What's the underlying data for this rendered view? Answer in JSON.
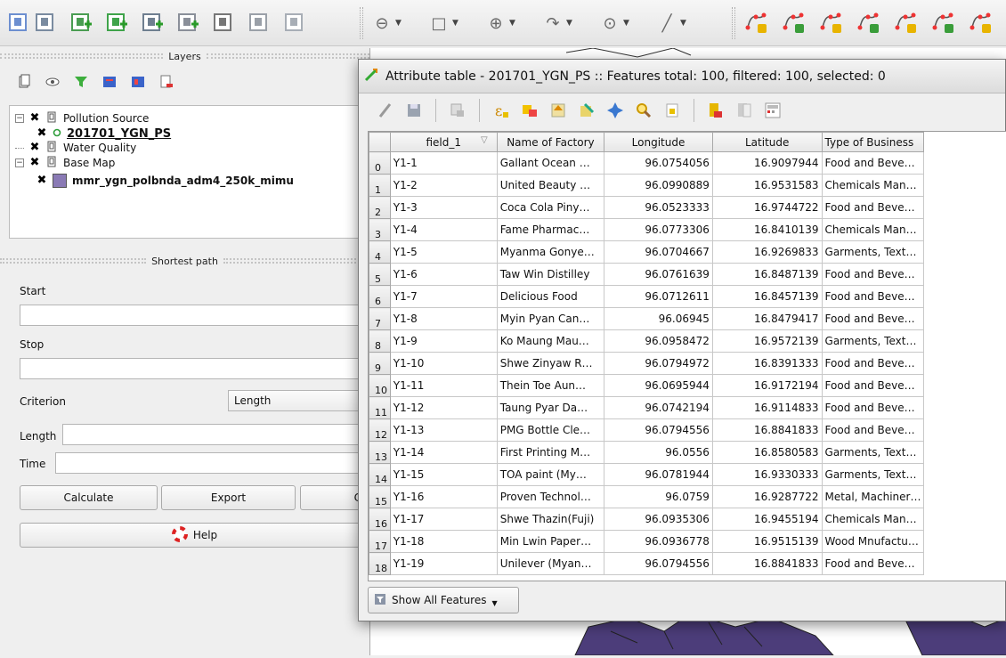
{
  "toolbar": {
    "icons": [
      "add-layer-icon",
      "remove-layer-icon",
      "new-vector-icon",
      "add-feature-icon",
      "edit-vector-icon",
      "edit-vector2-icon",
      "identify-icon",
      "open-table-icon",
      "open-table2-icon"
    ],
    "dropdown_icons": [
      "pan-icon",
      "select-rect-icon",
      "measure-icon",
      "action-icon",
      "node-icon",
      "line-icon"
    ],
    "edit_icons": [
      "digitize1-icon",
      "digitize2-icon",
      "digitize3-icon",
      "digitize4-icon",
      "digitize5-icon",
      "digitize6-icon",
      "digitize7-icon"
    ]
  },
  "layers_panel": {
    "title": "Layers",
    "tree": [
      {
        "label": "Pollution Source",
        "level": 0,
        "expanded": true
      },
      {
        "label": "201701_YGN_PS",
        "level": 1,
        "bold": true,
        "underline": true
      },
      {
        "label": "Water Quality",
        "level": 0
      },
      {
        "label": "Base Map",
        "level": 0,
        "expanded": true
      },
      {
        "label": "mmr_ygn_polbnda_adm4_250k_mimu",
        "level": 1,
        "bold": true
      }
    ],
    "colors": {
      "polygon_swatch": "#8a7ab5",
      "point_symbol": "#2e9d3a"
    }
  },
  "shortest_path": {
    "title": "Shortest path",
    "start_label": "Start",
    "stop_label": "Stop",
    "criterion_label": "Criterion",
    "criterion_value": "Length",
    "length_label": "Length",
    "time_label": "Time",
    "calculate": "Calculate",
    "export": "Export",
    "clear_partial": "C",
    "help": "Help"
  },
  "attribute_table": {
    "title": "Attribute table - 201701_YGN_PS :: Features total: 100, filtered: 100, selected: 0",
    "columns": [
      "field_1",
      "Name of Factory",
      "Longitude",
      "Latitude",
      "Type of Business"
    ],
    "rows": [
      [
        "0",
        "Y1-1",
        "Gallant Ocean …",
        "96.0754056",
        "16.9097944",
        "Food and Beve…"
      ],
      [
        "1",
        "Y1-2",
        "United Beauty …",
        "96.0990889",
        "16.9531583",
        "Chemicals Man…"
      ],
      [
        "2",
        "Y1-3",
        "Coca Cola Piny…",
        "96.0523333",
        "16.9744722",
        "Food and Beve…"
      ],
      [
        "3",
        "Y1-4",
        "Fame Pharmac…",
        "96.0773306",
        "16.8410139",
        "Chemicals Man…"
      ],
      [
        "4",
        "Y1-5",
        "Myanma Gonye…",
        "96.0704667",
        "16.9269833",
        "Garments, Text…"
      ],
      [
        "5",
        "Y1-6",
        "Taw Win Distilley",
        "96.0761639",
        "16.8487139",
        "Food and Beve…"
      ],
      [
        "6",
        "Y1-7",
        "Delicious Food",
        "96.0712611",
        "16.8457139",
        "Food and Beve…"
      ],
      [
        "7",
        "Y1-8",
        "Myin Pyan Can…",
        "96.06945",
        "16.8479417",
        "Food and Beve…"
      ],
      [
        "8",
        "Y1-9",
        "Ko Maung Mau…",
        "96.0958472",
        "16.9572139",
        "Garments, Text…"
      ],
      [
        "9",
        "Y1-10",
        "Shwe Zinyaw R…",
        "96.0794972",
        "16.8391333",
        "Food and Beve…"
      ],
      [
        "10",
        "Y1-11",
        "Thein Toe Aun…",
        "96.0695944",
        "16.9172194",
        "Food and Beve…"
      ],
      [
        "11",
        "Y1-12",
        "Taung Pyar Da…",
        "96.0742194",
        "16.9114833",
        "Food and Beve…"
      ],
      [
        "12",
        "Y1-13",
        "PMG Bottle Cle…",
        "96.0794556",
        "16.8841833",
        "Food and Beve…"
      ],
      [
        "13",
        "Y1-14",
        "First Printing M…",
        "96.0556",
        "16.8580583",
        "Garments, Text…"
      ],
      [
        "14",
        "Y1-15",
        "TOA paint (My…",
        "96.0781944",
        "16.9330333",
        "Garments, Text…"
      ],
      [
        "15",
        "Y1-16",
        "Proven Technol…",
        "96.0759",
        "16.9287722",
        "Metal, Machiner…"
      ],
      [
        "16",
        "Y1-17",
        "Shwe Thazin(Fuji)",
        "96.0935306",
        "16.9455194",
        "Chemicals Man…"
      ],
      [
        "17",
        "Y1-18",
        "Min Lwin Paper…",
        "96.0936778",
        "16.9515139",
        "Wood Mnufactu…"
      ],
      [
        "18",
        "Y1-19",
        "Unilever (Myan…",
        "96.0794556",
        "16.8841833",
        "Food and Beve…"
      ]
    ],
    "show_all": "Show All Features"
  }
}
